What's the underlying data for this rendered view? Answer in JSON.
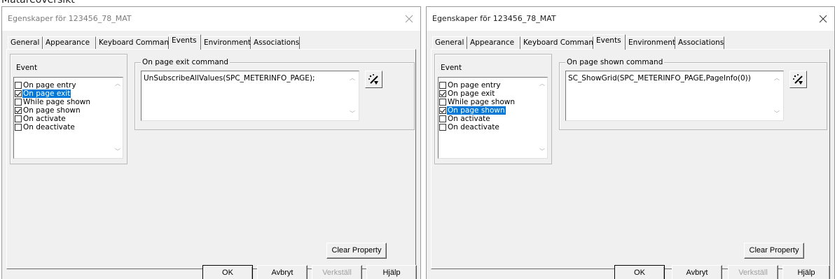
{
  "page_heading": "Mätareöversikt",
  "dialogs": [
    {
      "title": "Egenskaper för 123456_78_MAT",
      "tabs": [
        "General",
        "Appearance",
        "Keyboard Commands",
        "Events",
        "Environment",
        "Associations"
      ],
      "active_tab": "Events",
      "event_group_label": "Event",
      "events": [
        {
          "label": "On page entry",
          "checked": false,
          "selected": false
        },
        {
          "label": "On page exit",
          "checked": true,
          "selected": true
        },
        {
          "label": "While page shown",
          "checked": false,
          "selected": false
        },
        {
          "label": "On page shown",
          "checked": true,
          "selected": false
        },
        {
          "label": "On activate",
          "checked": false,
          "selected": false
        },
        {
          "label": "On deactivate",
          "checked": false,
          "selected": false
        }
      ],
      "command_group_label": "On page exit command",
      "command_value": "UnSubscribeAllValues(SPC_METERINFO_PAGE);",
      "clear_property_label": "Clear Property",
      "buttons": {
        "ok": "OK",
        "cancel": "Avbryt",
        "apply": "Verkställ",
        "help": "Hjälp"
      }
    },
    {
      "title": "Egenskaper för 123456_78_MAT",
      "tabs": [
        "General",
        "Appearance",
        "Keyboard Commands",
        "Events",
        "Environment",
        "Associations"
      ],
      "active_tab": "Events",
      "event_group_label": "Event",
      "events": [
        {
          "label": "On page entry",
          "checked": false,
          "selected": false
        },
        {
          "label": "On page exit",
          "checked": true,
          "selected": false
        },
        {
          "label": "While page shown",
          "checked": false,
          "selected": false
        },
        {
          "label": "On page shown",
          "checked": true,
          "selected": true
        },
        {
          "label": "On activate",
          "checked": false,
          "selected": false
        },
        {
          "label": "On deactivate",
          "checked": false,
          "selected": false
        }
      ],
      "command_group_label": "On page shown command",
      "command_value": "SC_ShowGrid(SPC_METERINFO_PAGE,PageInfo(0))",
      "clear_property_label": "Clear Property",
      "buttons": {
        "ok": "OK",
        "cancel": "Avbryt",
        "apply": "Verkställ",
        "help": "Hjälp"
      }
    }
  ],
  "colors": {
    "selection": "#0078d7",
    "dialog_bg": "#f0f0f0",
    "disabled_text": "#a0a0a0"
  },
  "icons": [
    "close-icon",
    "magic-wand-icon",
    "scroll-up-arrow-icon",
    "scroll-down-arrow-icon"
  ]
}
